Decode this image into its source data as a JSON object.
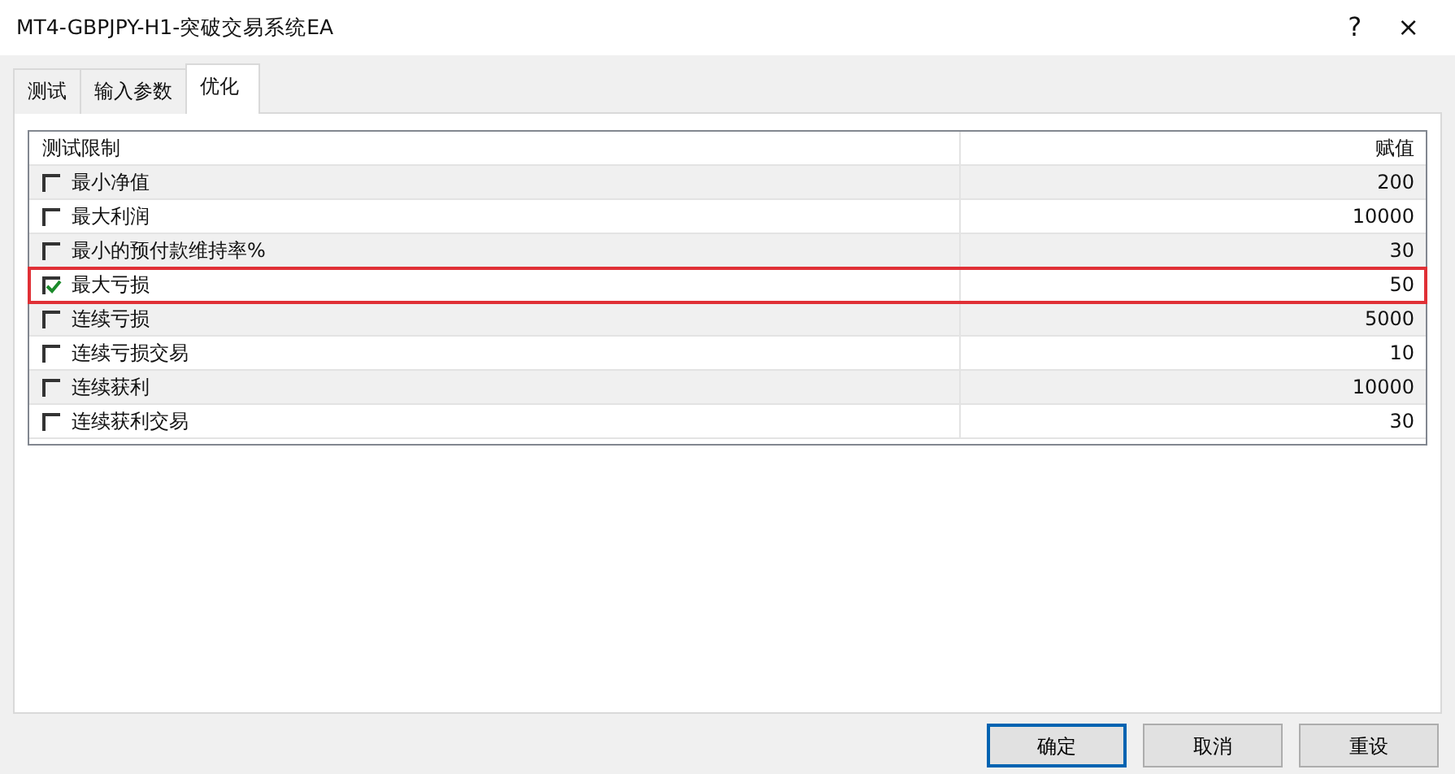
{
  "window": {
    "title": "MT4-GBPJPY-H1-突破交易系统EA",
    "help": "?",
    "close": "×"
  },
  "tabs": [
    {
      "label": "测试",
      "selected": false
    },
    {
      "label": "输入参数",
      "selected": false
    },
    {
      "label": "优化",
      "selected": true
    }
  ],
  "table": {
    "columns": [
      "测试限制",
      "赋值"
    ],
    "rows": [
      {
        "name": "最小净值",
        "checked": false,
        "value": "200",
        "highlighted": false
      },
      {
        "name": "最大利润",
        "checked": false,
        "value": "10000",
        "highlighted": false
      },
      {
        "name": "最小的预付款维持率%",
        "checked": false,
        "value": "30",
        "highlighted": false
      },
      {
        "name": "最大亏损",
        "checked": true,
        "value": "50",
        "highlighted": true
      },
      {
        "name": "连续亏损",
        "checked": false,
        "value": "5000",
        "highlighted": false
      },
      {
        "name": "连续亏损交易",
        "checked": false,
        "value": "10",
        "highlighted": false
      },
      {
        "name": "连续获利",
        "checked": false,
        "value": "10000",
        "highlighted": false
      },
      {
        "name": "连续获利交易",
        "checked": false,
        "value": "30",
        "highlighted": false
      }
    ]
  },
  "buttons": [
    {
      "label": "确定",
      "default": true
    },
    {
      "label": "取消",
      "default": false
    },
    {
      "label": "重设",
      "default": false
    }
  ]
}
